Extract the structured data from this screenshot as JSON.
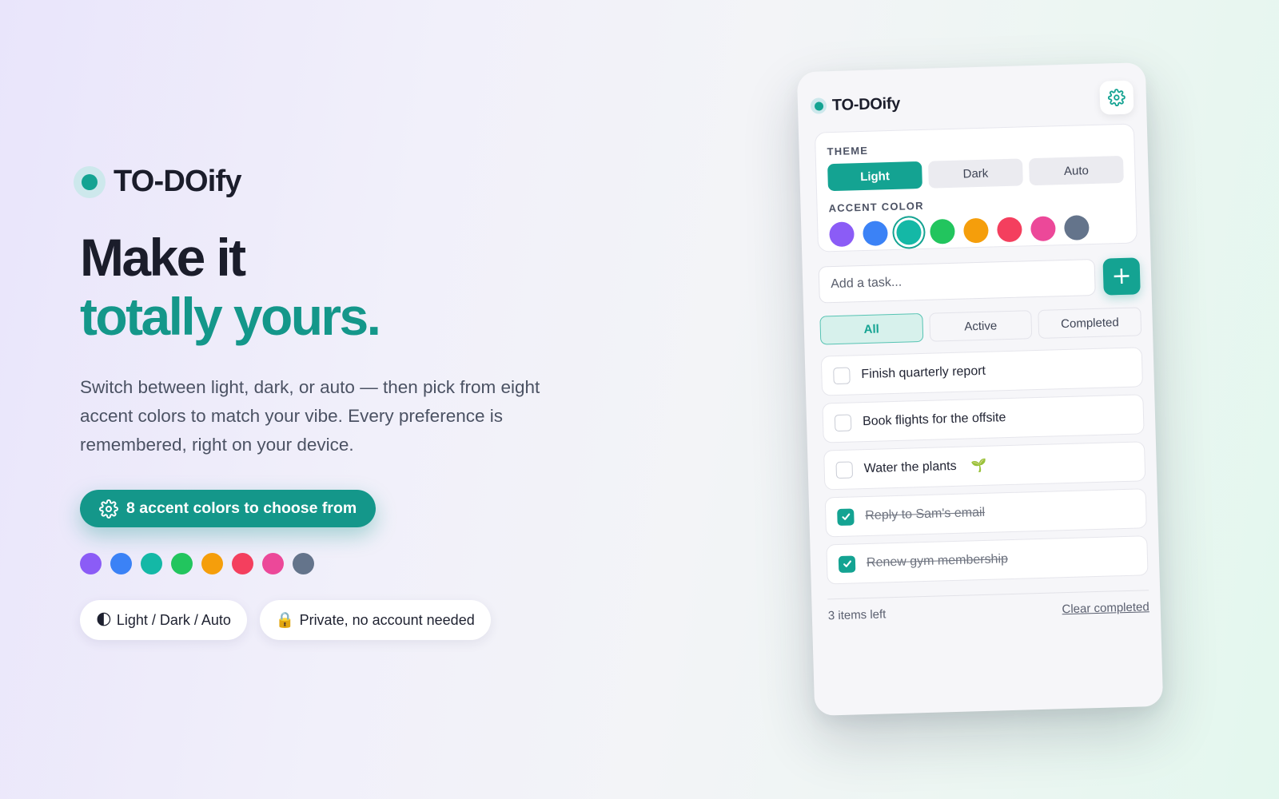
{
  "brand": {
    "name": "TO-DOify"
  },
  "hero": {
    "headline_line1": "Make it",
    "headline_line2": "totally yours.",
    "description": "Switch between light, dark, or auto — then pick from eight accent colors to match your vibe. Every preference is remembered, right on your device.",
    "cta_label": "8 accent colors to choose from",
    "swatch_colors": [
      "#8b5cf6",
      "#3b82f6",
      "#14b8a6",
      "#22c55e",
      "#f59e0b",
      "#f43f5e",
      "#ec4899",
      "#64748b"
    ],
    "pills": [
      {
        "icon": "🌓",
        "label": "Light / Dark / Auto"
      },
      {
        "icon": "🔒",
        "label": "Private, no account needed"
      }
    ]
  },
  "app": {
    "title": "TO-DOify",
    "theme_label": "THEME",
    "theme_options": [
      "Light",
      "Dark",
      "Auto"
    ],
    "theme_selected": "Light",
    "accent_label": "ACCENT COLOR",
    "accent_colors": [
      "#8b5cf6",
      "#3b82f6",
      "#14b8a6",
      "#22c55e",
      "#f59e0b",
      "#f43f5e",
      "#ec4899",
      "#64748b"
    ],
    "accent_selected_index": 2,
    "add_placeholder": "Add a task...",
    "add_button": "+",
    "filters": [
      "All",
      "Active",
      "Completed"
    ],
    "filter_selected": "All",
    "tasks": [
      {
        "text": "Finish quarterly report",
        "done": false
      },
      {
        "text": "Book flights for the offsite",
        "done": false
      },
      {
        "text": "Water the plants",
        "done": false,
        "emoji": "🌱"
      },
      {
        "text": "Reply to Sam's email",
        "done": true
      },
      {
        "text": "Renew gym membership",
        "done": true
      }
    ],
    "items_left": "3 items left",
    "clear_completed": "Clear completed"
  },
  "colors": {
    "accent": "#14a392",
    "heading_accent": "#14978a"
  }
}
